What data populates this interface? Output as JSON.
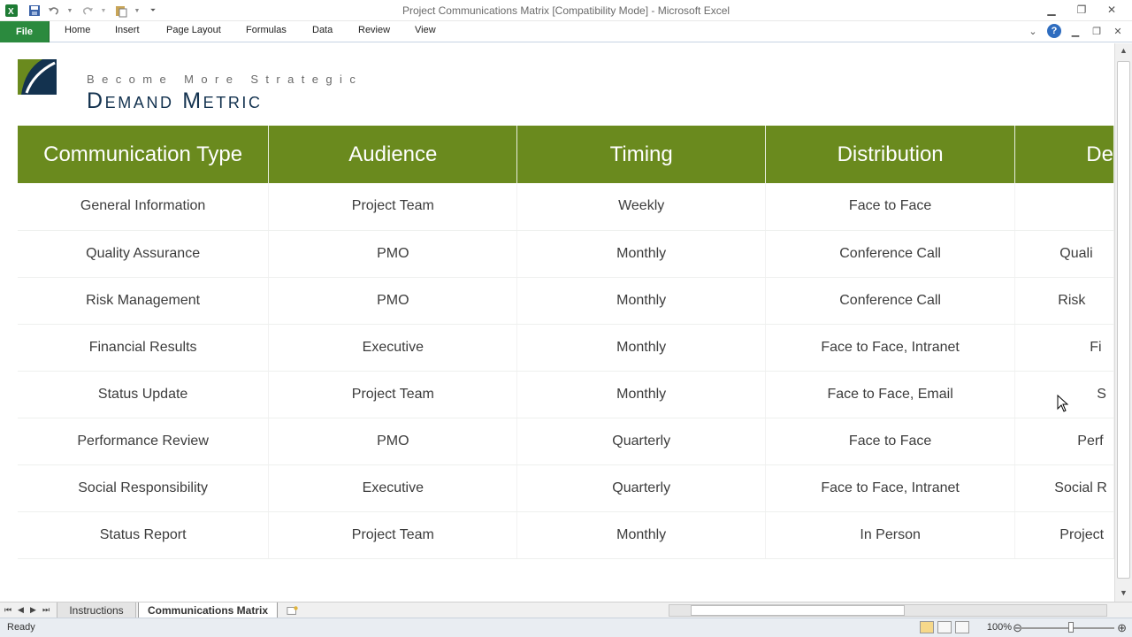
{
  "window": {
    "title": "Project Communications Matrix  [Compatibility Mode]  -  Microsoft Excel"
  },
  "ribbon": {
    "tabs": [
      "File",
      "Home",
      "Insert",
      "Page Layout",
      "Formulas",
      "Data",
      "Review",
      "View"
    ],
    "file_color": "#2b8a3e"
  },
  "logo": {
    "tagline": "Become More Strategic",
    "brand": "Demand Metric"
  },
  "matrix": {
    "header_color": "#6a8a1e",
    "columns": [
      "Communication Type",
      "Audience",
      "Timing",
      "Distribution",
      "De"
    ],
    "rows": [
      [
        "General Information",
        "Project Team",
        "Weekly",
        "Face to Face",
        ""
      ],
      [
        "Quality Assurance",
        "PMO",
        "Monthly",
        "Conference Call",
        "Quali"
      ],
      [
        "Risk Management",
        "PMO",
        "Monthly",
        "Conference Call",
        "Risk"
      ],
      [
        "Financial Results",
        "Executive",
        "Monthly",
        "Face to Face, Intranet",
        "Fi"
      ],
      [
        "Status Update",
        "Project Team",
        "Monthly",
        "Face to Face, Email",
        "S"
      ],
      [
        "Performance Review",
        "PMO",
        "Quarterly",
        "Face to Face",
        "Perf"
      ],
      [
        "Social Responsibility",
        "Executive",
        "Quarterly",
        "Face to Face, Intranet",
        "Social R"
      ],
      [
        "Status Report",
        "Project Team",
        "Monthly",
        "In Person",
        "Project"
      ]
    ]
  },
  "sheet_tabs": {
    "items": [
      "Instructions",
      "Communications Matrix"
    ],
    "active": "Communications Matrix"
  },
  "status_bar": {
    "ready": "Ready",
    "zoom": "100%"
  }
}
